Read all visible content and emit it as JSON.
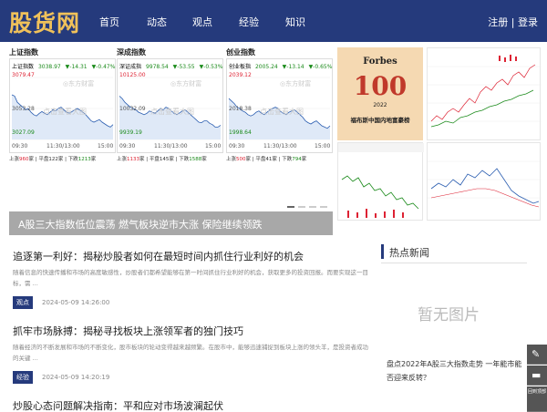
{
  "header": {
    "logo": "股货网",
    "nav": [
      "首页",
      "动态",
      "观点",
      "经验",
      "知识"
    ],
    "register": "注册",
    "separator": "|",
    "login": "登录"
  },
  "panels": [
    {
      "title": "上证指数",
      "name": "上证指数",
      "value": "3038.97",
      "change": "▼-14.31",
      "pct": "▼-0.47%",
      "max": "3079.47",
      "mid": "3053.28",
      "min": "3027.09",
      "watermark": "◎东方财富",
      "hint": "点击查看大图",
      "ticks": [
        "09:30",
        "11:30/13:00",
        "15:00"
      ],
      "stats": {
        "up_label": "上涨",
        "up": "960",
        "flat_label": "平盘",
        "flat": "122",
        "down_label": "下跌",
        "down": "1213",
        "unit": "家"
      },
      "series": [
        0.72,
        0.7,
        0.6,
        0.56,
        0.52,
        0.48,
        0.5,
        0.44,
        0.4,
        0.38,
        0.42,
        0.45,
        0.42,
        0.4,
        0.44,
        0.48,
        0.46,
        0.5,
        0.52,
        0.48,
        0.44,
        0.42,
        0.45,
        0.48,
        0.5,
        0.47,
        0.44,
        0.4,
        0.35,
        0.3,
        0.28,
        0.3,
        0.32,
        0.28,
        0.25,
        0.22,
        0.2,
        0.24
      ]
    },
    {
      "title": "深成指数",
      "name": "深证成指",
      "value": "9978.54",
      "change": "▼-53.55",
      "pct": "▼-0.53%",
      "max": "10125.00",
      "mid": "10032.09",
      "min": "9939.19",
      "watermark": "◎东方财富",
      "hint": "点击查看大图",
      "ticks": [
        "09:30",
        "11:30/13:00",
        "15:00"
      ],
      "stats": {
        "up_label": "上涨",
        "up": "1133",
        "flat_label": "平盘",
        "flat": "145",
        "down_label": "下跌",
        "down": "1588",
        "unit": "家"
      },
      "series": [
        0.7,
        0.66,
        0.6,
        0.56,
        0.52,
        0.5,
        0.48,
        0.44,
        0.42,
        0.4,
        0.42,
        0.46,
        0.44,
        0.42,
        0.46,
        0.5,
        0.48,
        0.52,
        0.5,
        0.46,
        0.42,
        0.4,
        0.43,
        0.46,
        0.48,
        0.44,
        0.4,
        0.36,
        0.32,
        0.28,
        0.27,
        0.3,
        0.3,
        0.26,
        0.24,
        0.2,
        0.2,
        0.23
      ]
    },
    {
      "title": "创业指数",
      "name": "创业板指",
      "value": "2005.24",
      "change": "▼-13.14",
      "pct": "▼-0.65%",
      "max": "2039.12",
      "mid": "2018.38",
      "min": "1998.64",
      "watermark": "◎东方财富",
      "hint": "点击查看大图",
      "ticks": [
        "09:30",
        "11:30/13:00",
        "15:00"
      ],
      "stats": {
        "up_label": "上涨",
        "up": "500",
        "flat_label": "平盘",
        "flat": "41",
        "down_label": "下跌",
        "down": "794",
        "unit": "家"
      },
      "series": [
        0.66,
        0.62,
        0.58,
        0.52,
        0.5,
        0.46,
        0.44,
        0.4,
        0.38,
        0.4,
        0.44,
        0.46,
        0.42,
        0.4,
        0.44,
        0.48,
        0.5,
        0.52,
        0.5,
        0.45,
        0.42,
        0.4,
        0.44,
        0.46,
        0.48,
        0.44,
        0.4,
        0.36,
        0.3,
        0.27,
        0.25,
        0.28,
        0.3,
        0.26,
        0.22,
        0.2,
        0.18,
        0.22
      ]
    }
  ],
  "forbes": {
    "brand": "Forbes",
    "number": "100",
    "year": "2022",
    "caption": "福布斯中国内地富豪榜"
  },
  "banner": {
    "text": "A股三大指数低位震荡 燃气板块逆市大涨 保险继续领跌"
  },
  "articles": [
    {
      "title": "追逐第一利好：揭秘炒股者如何在最短时间内抓住行业利好的机会",
      "desc": "随着信息的快速传播和市场的高度敏感性，炒股者们都希望能够在第一时间抓住行业利好的机会，获取更多的投资回报。而要实现这一目标，需 ...",
      "tag": "观点",
      "time": "2024-05-09 14:26:00"
    },
    {
      "title": "抓牢市场脉搏：揭秘寻找板块上涨领军者的独门技巧",
      "desc": "随着经济的不断发展和市场的不断变化，股市板块的轮动变得越来越频繁。在股市中，能够迅速捕捉到板块上涨的领头羊，是投资者成功的关键 ...",
      "tag": "经验",
      "time": "2024-05-09 14:20:19"
    },
    {
      "title": "炒股心态问题解决指南：平和应对市场波澜起伏",
      "desc": "",
      "tag": "",
      "time": ""
    }
  ],
  "sidebar": {
    "hot_title": "热点新闻",
    "no_image": "暂无图片",
    "hot_item": "盘点2022年A股三大指数走势 一年能市能否迎来反转？"
  },
  "float": {
    "feedback_label": "反馈",
    "chat_label": "客服",
    "top_label": "回到顶部"
  }
}
